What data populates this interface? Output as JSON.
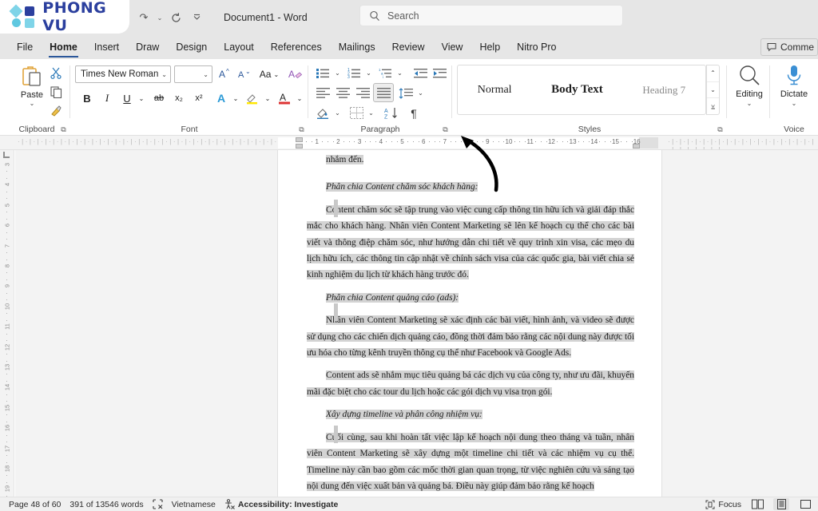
{
  "titlebar": {
    "logo_text": "PHONG VU",
    "doc_title": "Document1  -  Word",
    "qat": [
      {
        "name": "redo-icon",
        "glyph": "↷"
      },
      {
        "name": "qat-caret-icon",
        "glyph": "⌄"
      },
      {
        "name": "refresh-icon",
        "glyph": "↻"
      },
      {
        "name": "qat-more-icon",
        "glyph": "⩣"
      }
    ],
    "search": {
      "placeholder": "Search",
      "icon": "search-icon"
    }
  },
  "tabs": [
    {
      "label": "File",
      "active": false
    },
    {
      "label": "Home",
      "active": true
    },
    {
      "label": "Insert",
      "active": false
    },
    {
      "label": "Draw",
      "active": false
    },
    {
      "label": "Design",
      "active": false
    },
    {
      "label": "Layout",
      "active": false
    },
    {
      "label": "References",
      "active": false
    },
    {
      "label": "Mailings",
      "active": false
    },
    {
      "label": "Review",
      "active": false
    },
    {
      "label": "View",
      "active": false
    },
    {
      "label": "Help",
      "active": false
    },
    {
      "label": "Nitro Pro",
      "active": false
    }
  ],
  "comments_button": {
    "label": "Comme",
    "icon": "comment-icon"
  },
  "ribbon": {
    "clipboard": {
      "group_label": "Clipboard",
      "paste_label": "Paste",
      "cut_icon": "scissors-icon",
      "copy_icon": "copy-icon",
      "format_painter_icon": "format-painter-icon"
    },
    "font": {
      "group_label": "Font",
      "font_name": "Times New Roman",
      "font_size": "",
      "grow_font": "A^",
      "shrink_font": "A⌄",
      "change_case": "Aa",
      "clear_formatting": "clear-formatting-icon",
      "bold": "B",
      "italic": "I",
      "underline": "U",
      "strikethrough": "ab",
      "subscript": "x₂",
      "superscript": "x²",
      "text_effects": "A",
      "highlight": "highlight-icon",
      "font_color": "A"
    },
    "paragraph": {
      "group_label": "Paragraph",
      "bullets": "bullets-icon",
      "numbering": "numbering-icon",
      "multilevel": "multilevel-list-icon",
      "decrease_indent": "decrease-indent-icon",
      "increase_indent": "increase-indent-icon",
      "align_left": "align-left-icon",
      "align_center": "align-center-icon",
      "align_right": "align-right-icon",
      "justify": "justify-icon",
      "line_spacing": "line-spacing-icon",
      "shading": "shading-icon",
      "borders": "borders-icon",
      "sort": "sort-icon",
      "show_marks": "¶"
    },
    "styles": {
      "group_label": "Styles",
      "items": [
        "Normal",
        "Body Text",
        "Heading 7"
      ]
    },
    "editing": {
      "label": "Editing",
      "icon": "magnifier-icon"
    },
    "voice": {
      "group_label": "Voice",
      "label": "Dictate",
      "icon": "microphone-icon"
    }
  },
  "ruler": {
    "h_numbers": [
      "1",
      "2",
      "3",
      "4",
      "5",
      "6",
      "7",
      "8",
      "9",
      "10",
      "11",
      "12",
      "13",
      "14",
      "15",
      "16"
    ],
    "v_numbers": [
      "3",
      "4",
      "5",
      "6",
      "7",
      "8",
      "9",
      "10",
      "11",
      "12",
      "13",
      "14",
      "15",
      "16",
      "17",
      "18",
      "19"
    ]
  },
  "document": {
    "lines": [
      {
        "id": "l0",
        "text": "nhắm đến.",
        "style": "plain",
        "hl_width": "100%"
      },
      {
        "id": "sub1",
        "text": "Phân chia Content chăm sóc khách hàng:",
        "style": "subhead"
      },
      {
        "id": "p1",
        "text": "Content chăm sóc sẽ tập trung vào việc cung cấp thông tin hữu ích và giải đáp thắc mắc cho khách hàng. Nhân viên Content Marketing sẽ lên kế hoạch cụ thể cho các bài viết và thông điệp chăm sóc, như hướng dẫn chi tiết về quy trình xin visa, các mẹo du lịch hữu ích, các thông tin cập nhật về chính sách visa của các quốc gia, bài viết chia sẻ kinh nghiệm du lịch từ khách hàng trước đó.",
        "style": "para"
      },
      {
        "id": "sub2",
        "text": "Phân chia Content quảng cáo (ads):",
        "style": "subhead"
      },
      {
        "id": "p2",
        "text": "Nhân viên Content Marketing sẽ xác định các bài viết, hình ảnh, và video sẽ được sử dụng cho các chiến dịch quảng cáo, đồng thời đảm bảo rằng các nội dung này được tối ưu hóa cho từng kênh truyền thông cụ thể như Facebook và Google Ads.",
        "style": "para"
      },
      {
        "id": "p3",
        "text": "Content ads sẽ nhắm mục tiêu quảng bá các dịch vụ của công ty, như ưu đãi, khuyến mãi đặc biệt cho các tour du lịch hoặc các gói dịch vụ visa trọn gói.",
        "style": "para"
      },
      {
        "id": "sub3",
        "text": "Xây dựng timeline và phân công nhiệm vụ:",
        "style": "subhead"
      },
      {
        "id": "p4",
        "text": "Cuối cùng, sau khi hoàn tất việc lập kế hoạch nội dung theo tháng và tuần, nhân viên Content Marketing sẽ xây dựng một timeline chi tiết và các nhiệm vụ cụ thể. Timeline này cần bao gồm các mốc thời gian quan trọng, từ việc nghiên cứu và sáng tạo nội dung đến việc xuất bản và quảng bá. Điều này giúp đảm bảo rằng kế hoạch",
        "style": "para"
      }
    ]
  },
  "statusbar": {
    "page": "Page 48 of 60",
    "words": "391 of 13546 words",
    "proofing_icon": "proofing-errors-icon",
    "language": "Vietnamese",
    "accessibility_icon": "accessibility-icon",
    "accessibility": "Accessibility: Investigate",
    "focus_icon": "focus-icon",
    "focus": "Focus",
    "views": [
      {
        "name": "read-mode-icon",
        "active": false
      },
      {
        "name": "print-layout-icon",
        "active": true
      },
      {
        "name": "web-layout-icon",
        "active": false
      }
    ]
  },
  "colors": {
    "accent": "#2b579a",
    "logo_blue": "#2b3f9e",
    "logo_cyan": "#7fd4e8",
    "highlight": "#d3d3d3"
  }
}
